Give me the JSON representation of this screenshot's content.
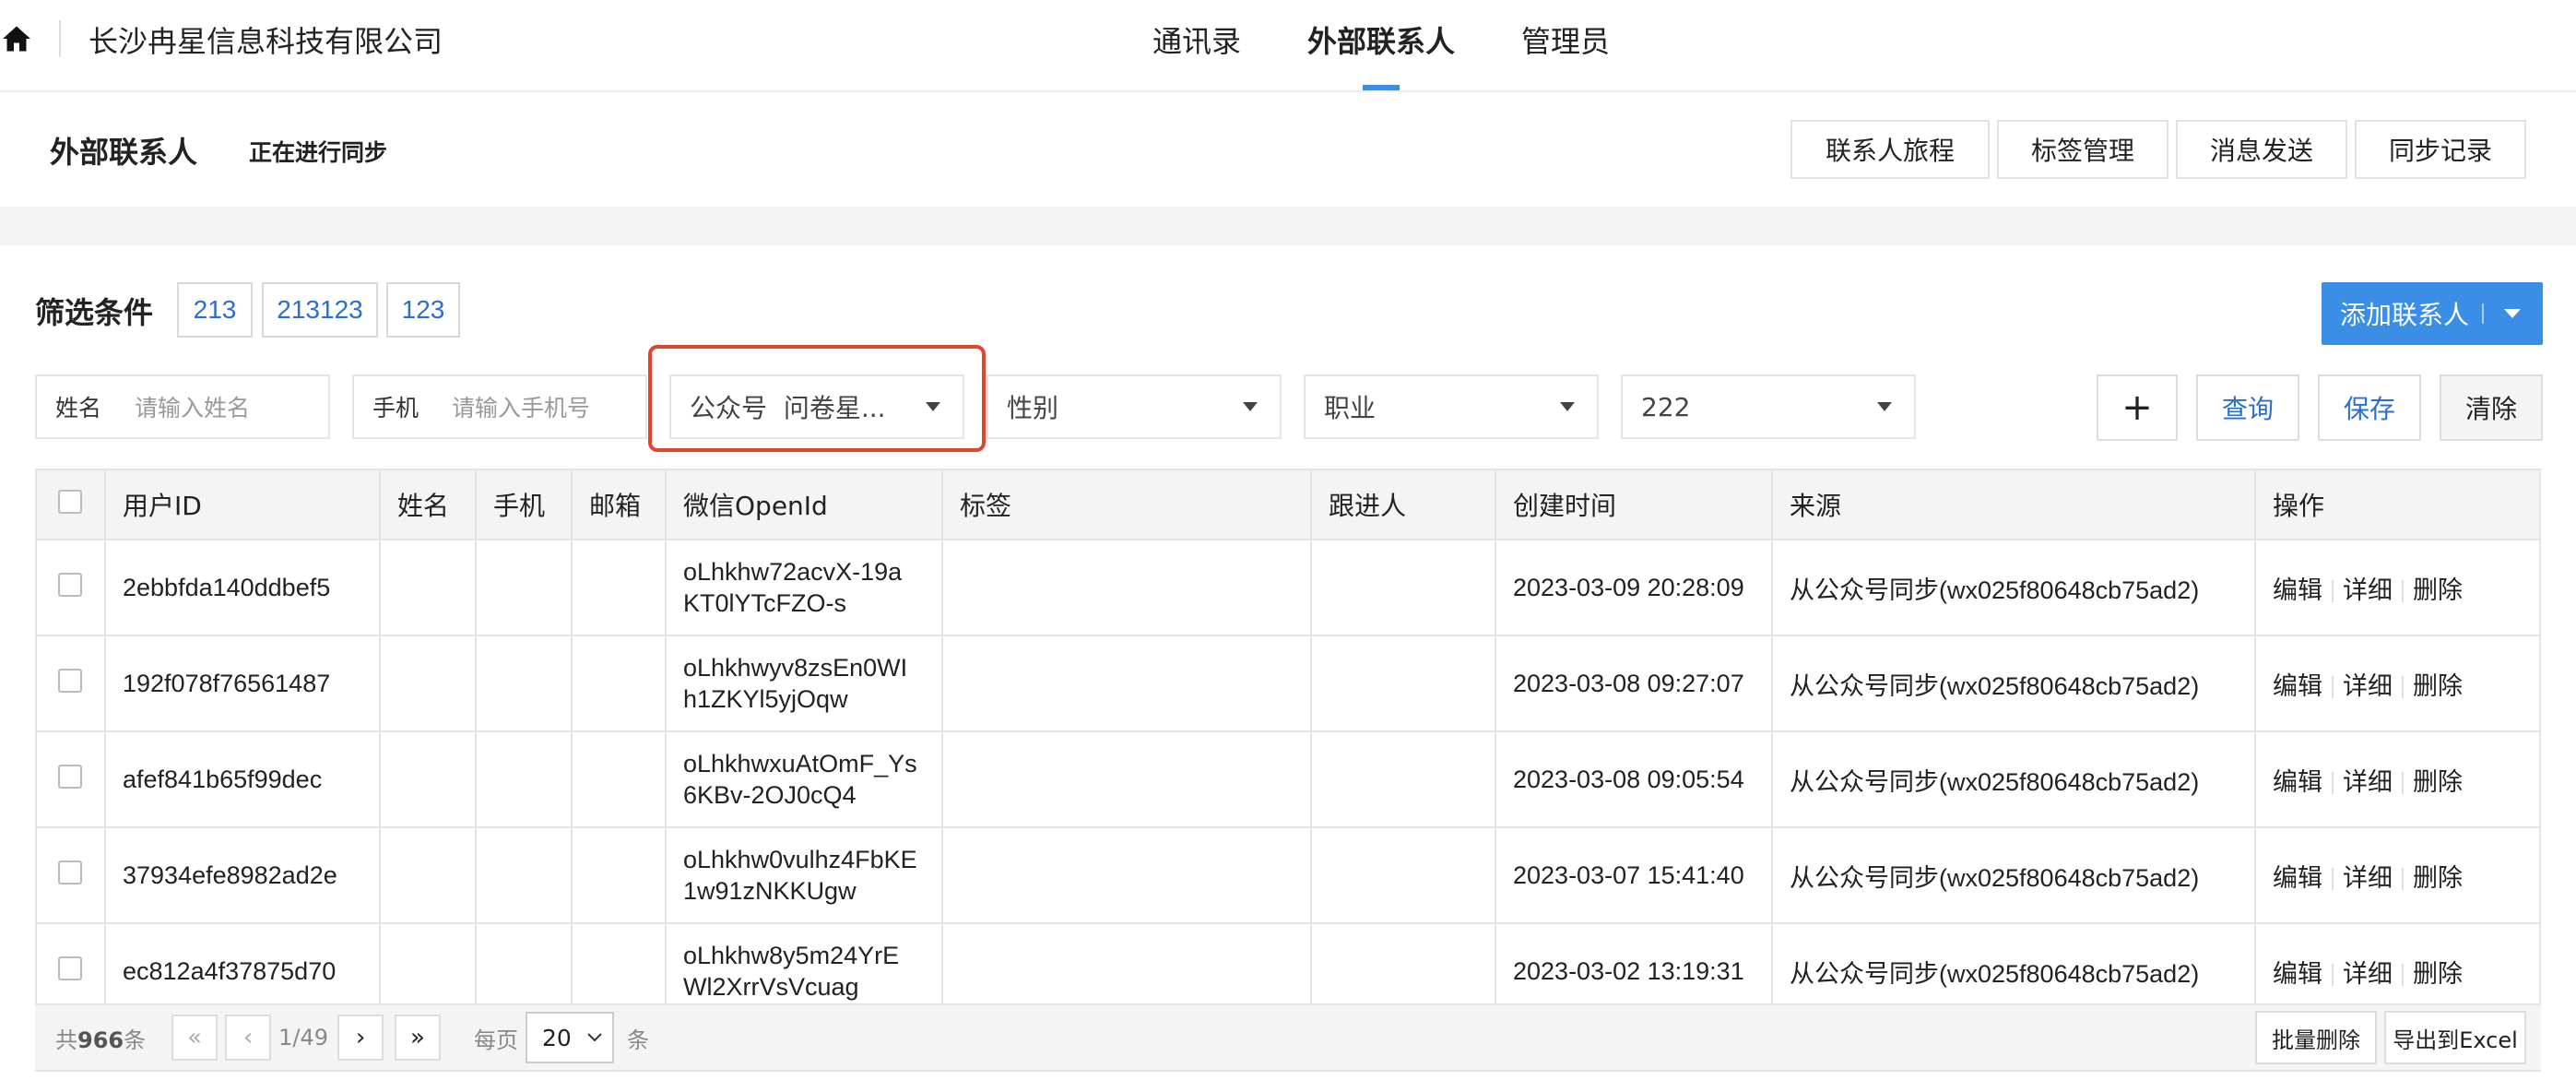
{
  "header": {
    "company": "长沙冉星信息科技有限公司",
    "nav": [
      "通讯录",
      "外部联系人",
      "管理员"
    ],
    "active_nav": "外部联系人"
  },
  "subheader": {
    "title": "外部联系人",
    "status": "正在进行同步",
    "buttons": [
      "联系人旅程",
      "标签管理",
      "消息发送",
      "同步记录"
    ]
  },
  "filter": {
    "title": "筛选条件",
    "chips": [
      "213",
      "213123",
      "123"
    ],
    "add_button": "添加联系人",
    "name_label": "姓名",
    "name_placeholder": "请输入姓名",
    "phone_label": "手机",
    "phone_placeholder": "请输入手机号",
    "official_account_label": "公众号",
    "official_account_value": "问卷星...",
    "gender_placeholder": "性别",
    "job_placeholder": "职业",
    "custom_value": "222",
    "add_label": "+",
    "query_label": "查询",
    "save_label": "保存",
    "clear_label": "清除"
  },
  "table": {
    "columns": [
      "用户ID",
      "姓名",
      "手机",
      "邮箱",
      "微信OpenId",
      "标签",
      "跟进人",
      "创建时间",
      "来源",
      "操作"
    ],
    "rows": [
      {
        "id": "2ebbfda140ddbef5",
        "openid_1": "oLhkhw72acvX-19a",
        "openid_2": "KT0lYTcFZO-s",
        "created": "2023-03-09 20:28:09",
        "source": "从公众号同步(wx025f80648cb75ad2)"
      },
      {
        "id": "192f078f76561487",
        "openid_1": "oLhkhwyv8zsEn0WI",
        "openid_2": "h1ZKYl5yjOqw",
        "created": "2023-03-08 09:27:07",
        "source": "从公众号同步(wx025f80648cb75ad2)"
      },
      {
        "id": "afef841b65f99dec",
        "openid_1": "oLhkhwxuAtOmF_Ys",
        "openid_2": "6KBv-2OJ0cQ4",
        "created": "2023-03-08 09:05:54",
        "source": "从公众号同步(wx025f80648cb75ad2)"
      },
      {
        "id": "37934efe8982ad2e",
        "openid_1": "oLhkhw0vulhz4FbKE",
        "openid_2": "1w91zNKKUgw",
        "created": "2023-03-07 15:41:40",
        "source": "从公众号同步(wx025f80648cb75ad2)"
      },
      {
        "id": "ec812a4f37875d70",
        "openid_1": "oLhkhw8y5m24YrE",
        "openid_2": "Wl2XrrVsVcuag",
        "created": "2023-03-02 13:19:31",
        "source": "从公众号同步(wx025f80648cb75ad2)"
      }
    ],
    "ops": [
      "编辑",
      "详细",
      "删除"
    ]
  },
  "footer": {
    "total_prefix": "共",
    "total_count": "966",
    "total_suffix": "条",
    "page_info": "1/49",
    "per_page_label": "每页",
    "per_page_value": "20",
    "per_page_unit": "条",
    "batch_delete": "批量删除",
    "export": "导出到Excel"
  },
  "colors": {
    "accent": "#3a8ee6",
    "highlight": "#e0452e",
    "link": "#2a6fc9"
  }
}
